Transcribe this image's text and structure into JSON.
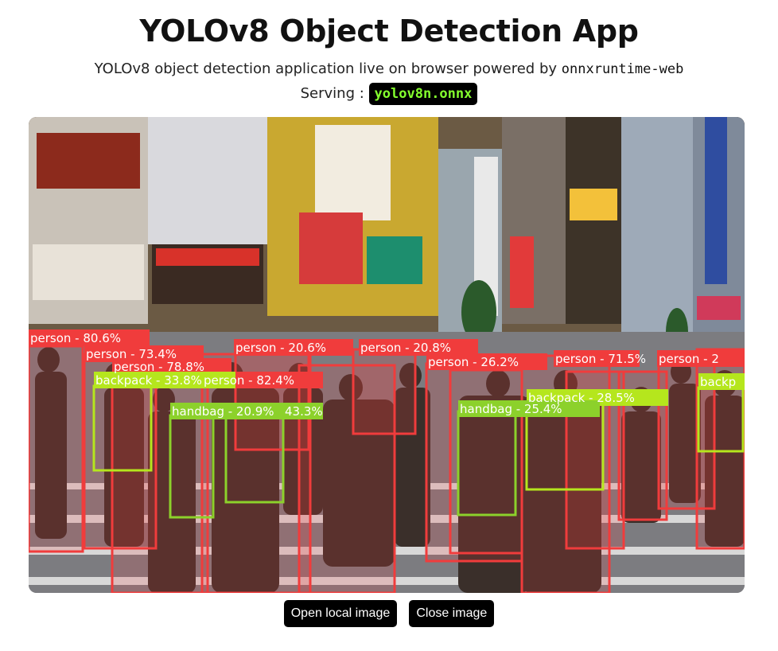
{
  "app": {
    "title": "YOLOv8 Object Detection App",
    "subtitle_prefix": "YOLOv8 object detection application live on browser powered by",
    "subtitle_code": "onnxruntime-web",
    "serving_label": "Serving :",
    "model_name": "yolov8n.onnx"
  },
  "colors": {
    "person": "#f03c3c",
    "backpack": "#b5e61d",
    "handbag": "#8cd12b",
    "model_badge_text": "#84ff2e"
  },
  "detections": [
    {
      "label": "person - 80.6%",
      "cls": "person"
    },
    {
      "label": "person - 73.4%",
      "cls": "person"
    },
    {
      "label": "person - 20.6%",
      "cls": "person"
    },
    {
      "label": "person - 20.8%",
      "cls": "person"
    },
    {
      "label": "person - 78.8%",
      "cls": "person"
    },
    {
      "label": "person - 26.2%",
      "cls": "person"
    },
    {
      "label": "person - 71.5%",
      "cls": "person"
    },
    {
      "label": "person - 2",
      "cls": "person"
    },
    {
      "label": "backpack - 33.8%",
      "cls": "backpack"
    },
    {
      "label": "person - 82.4%",
      "cls": "person"
    },
    {
      "label": "handbag - 20.9%",
      "cls": "handbag"
    },
    {
      "label": "43.3%",
      "cls": "handbag"
    },
    {
      "label": "handbag - 25.4%",
      "cls": "handbag"
    },
    {
      "label": "backpack - 28.5%",
      "cls": "backpack"
    },
    {
      "label": "backp",
      "cls": "backpack"
    }
  ],
  "buttons": {
    "open_label": "Open local image",
    "close_label": "Close image"
  }
}
